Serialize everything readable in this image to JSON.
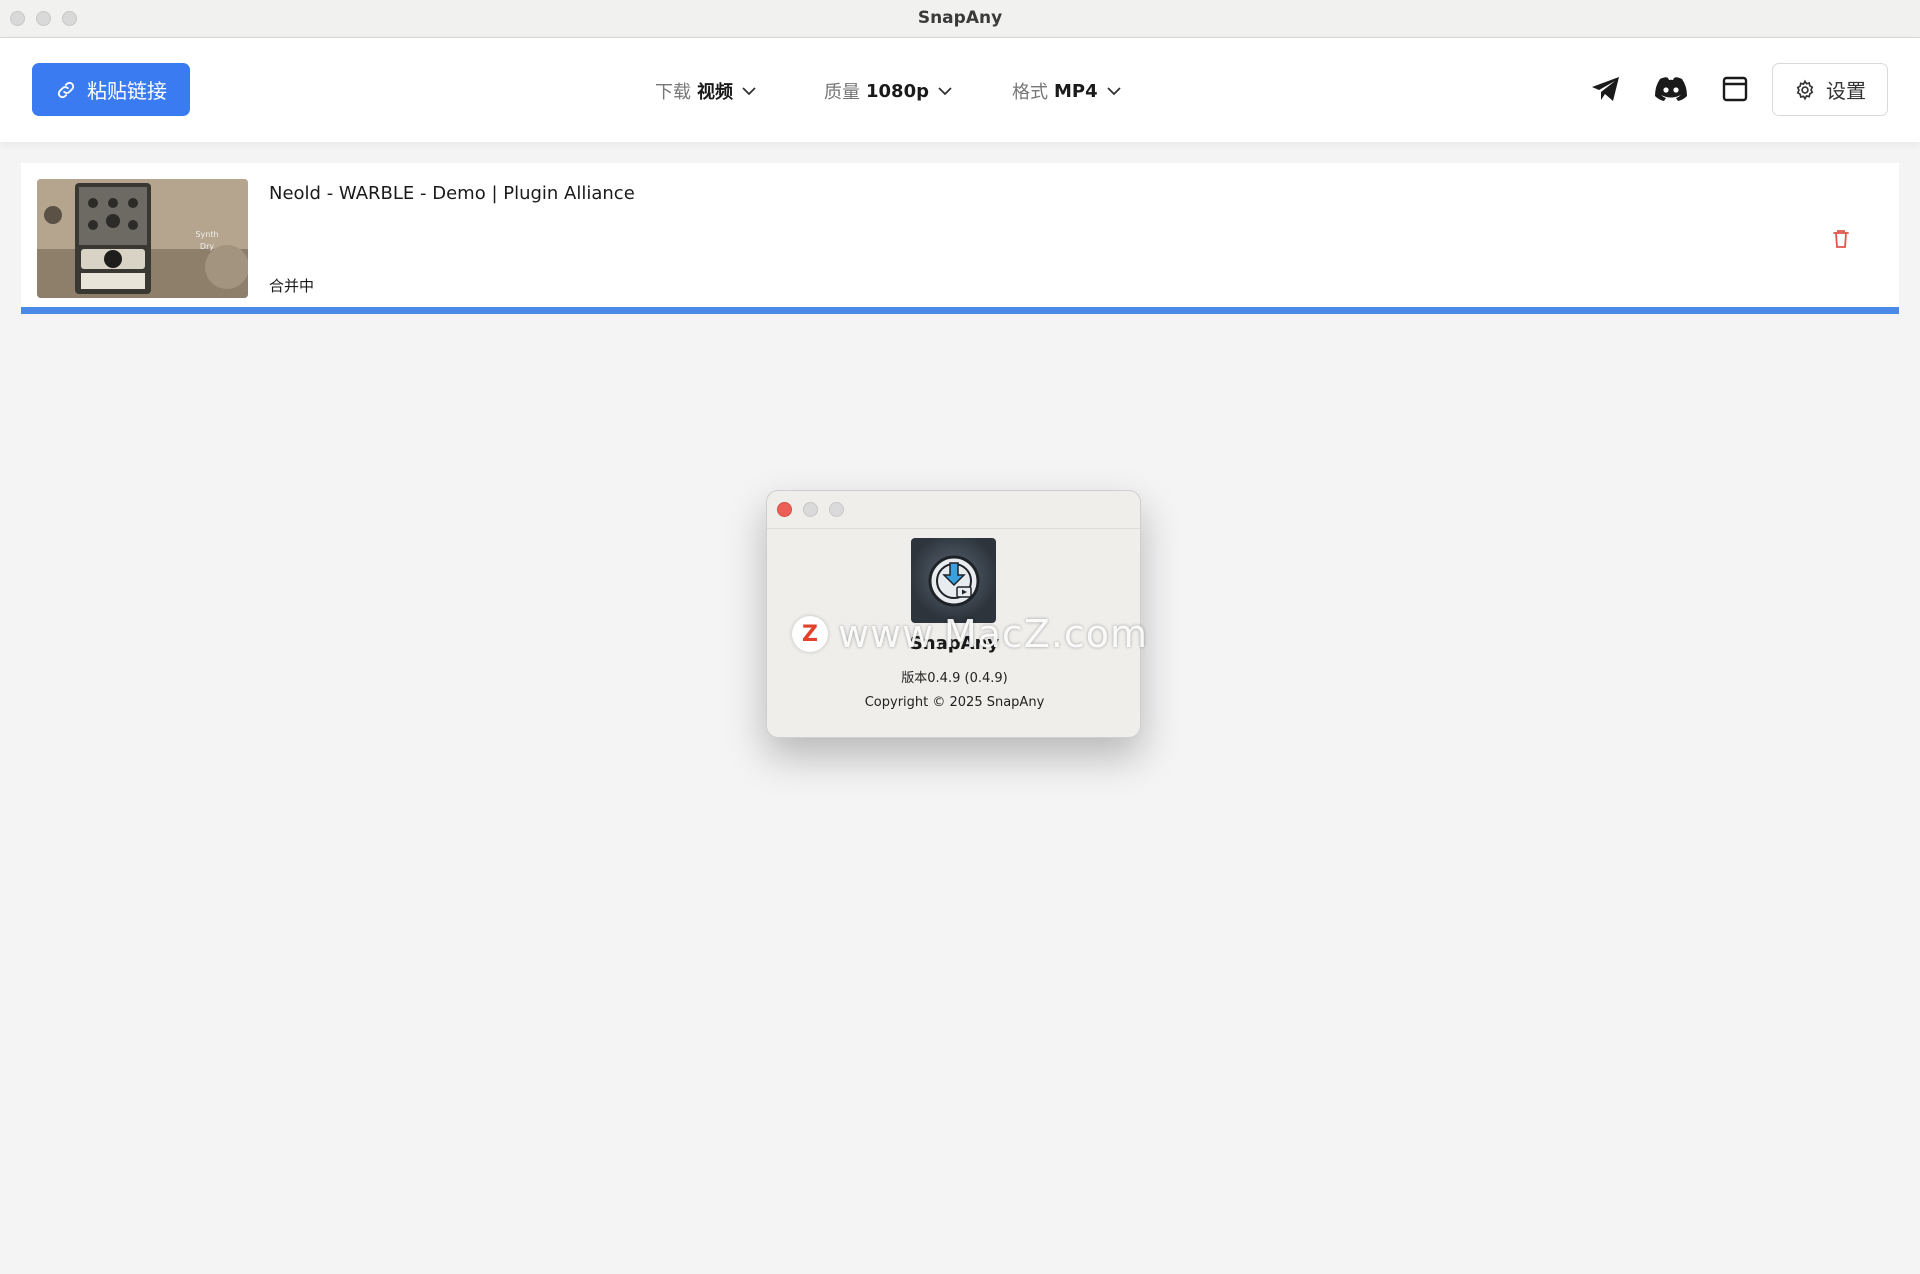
{
  "window": {
    "title": "SnapAny"
  },
  "toolbar": {
    "paste_label": "粘贴链接",
    "download": {
      "label": "下载",
      "value": "视频"
    },
    "quality": {
      "label": "质量",
      "value": "1080p"
    },
    "format": {
      "label": "格式",
      "value": "MP4"
    },
    "icons": [
      "telegram-icon",
      "discord-icon",
      "window-icon"
    ],
    "settings_label": "设置"
  },
  "downloads": [
    {
      "title": "Neold - WARBLE - Demo | Plugin Alliance",
      "thumbnail_text": [
        "Synth",
        "Dry"
      ],
      "status": "合并中",
      "progress": 1.0
    }
  ],
  "about_dialog": {
    "app_name": "SnapAny",
    "version": "版本0.4.9 (0.4.9)",
    "copyright": "Copyright © 2025 SnapAny"
  },
  "watermark": {
    "badge": "Z",
    "text": "www.MacZ.com"
  },
  "colors": {
    "accent": "#3b7bf2",
    "progress": "#4a8ae6",
    "danger": "#e0564a"
  }
}
